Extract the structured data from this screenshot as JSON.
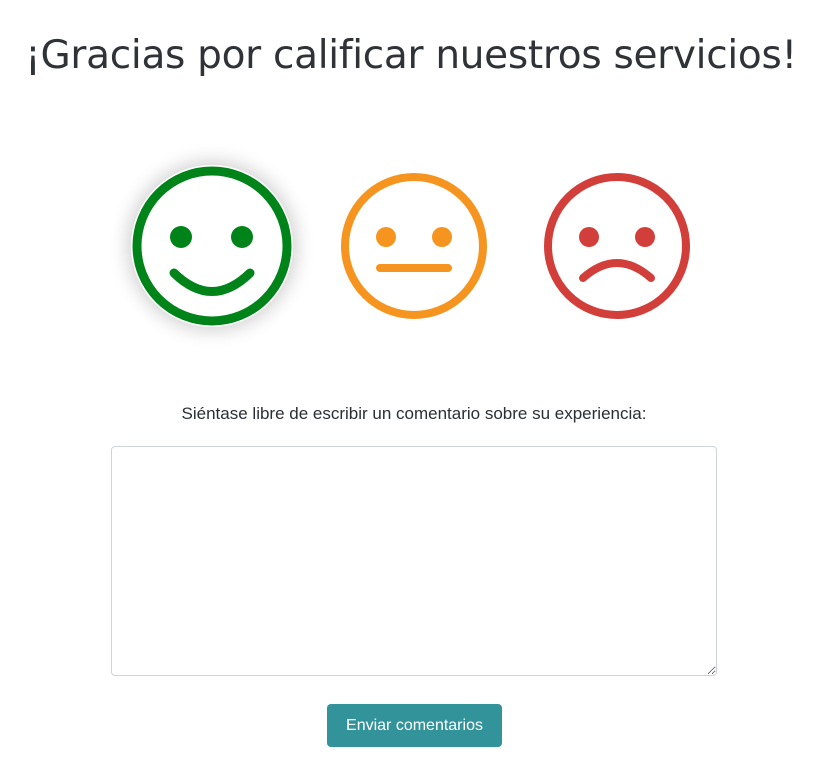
{
  "header": {
    "title": "¡Gracias por calificar nuestros servicios!"
  },
  "rating": {
    "selected": "good",
    "options": [
      {
        "id": "good",
        "icon": "smiling-face-icon",
        "color": "#00841a"
      },
      {
        "id": "neutral",
        "icon": "neutral-face-icon",
        "color": "#f5951f"
      },
      {
        "id": "bad",
        "icon": "sad-face-icon",
        "color": "#d23f3a"
      }
    ]
  },
  "comment": {
    "label": "Siéntase libre de escribir un comentario sobre su experiencia:",
    "value": "",
    "placeholder": ""
  },
  "submit": {
    "label": "Enviar comentarios",
    "color": "#33939b"
  }
}
